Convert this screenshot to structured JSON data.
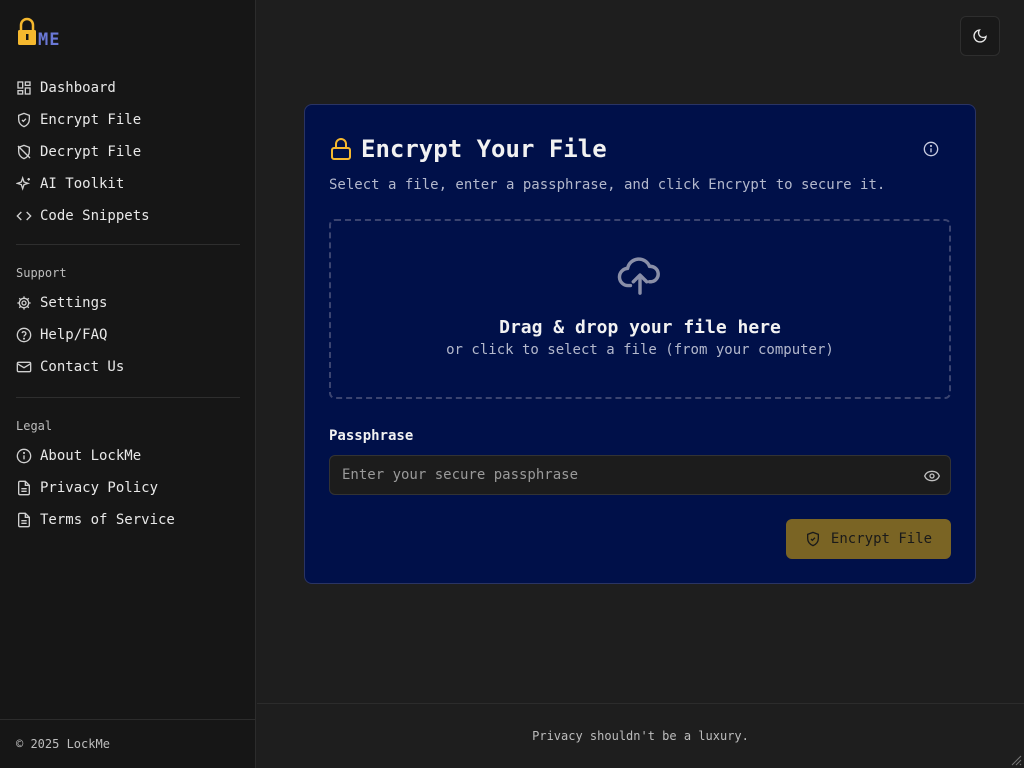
{
  "app": {
    "brand_text": "ME",
    "accent_color": "#f5b82e",
    "card_color": "#001049",
    "button_color": "#7a6424"
  },
  "sidebar": {
    "main_items": [
      {
        "label": "Dashboard",
        "icon": "dashboard-icon"
      },
      {
        "label": "Encrypt File",
        "icon": "shield-check-icon"
      },
      {
        "label": "Decrypt File",
        "icon": "shield-off-icon"
      },
      {
        "label": "AI Toolkit",
        "icon": "sparkles-icon"
      },
      {
        "label": "Code Snippets",
        "icon": "code-icon"
      }
    ],
    "support": {
      "label": "Support",
      "items": [
        {
          "label": "Settings",
          "icon": "gear-icon"
        },
        {
          "label": "Help/FAQ",
          "icon": "help-circle-icon"
        },
        {
          "label": "Contact Us",
          "icon": "mail-icon"
        }
      ]
    },
    "legal": {
      "label": "Legal",
      "items": [
        {
          "label": "About LockMe",
          "icon": "info-icon"
        },
        {
          "label": "Privacy Policy",
          "icon": "document-icon"
        },
        {
          "label": "Terms of Service",
          "icon": "document-icon"
        }
      ]
    },
    "footer": "© 2025 LockMe"
  },
  "header": {
    "theme_toggle_icon": "moon-icon"
  },
  "card": {
    "title": "Encrypt Your File",
    "description": "Select a file, enter a passphrase, and click Encrypt to secure it.",
    "dropzone": {
      "title": "Drag & drop your file here",
      "subtitle": "or click to select a file (from your computer)"
    },
    "passphrase": {
      "label": "Passphrase",
      "value": "",
      "placeholder": "Enter your secure passphrase"
    },
    "submit_label": "Encrypt File"
  },
  "footer": {
    "tagline": "Privacy shouldn't be a luxury."
  }
}
